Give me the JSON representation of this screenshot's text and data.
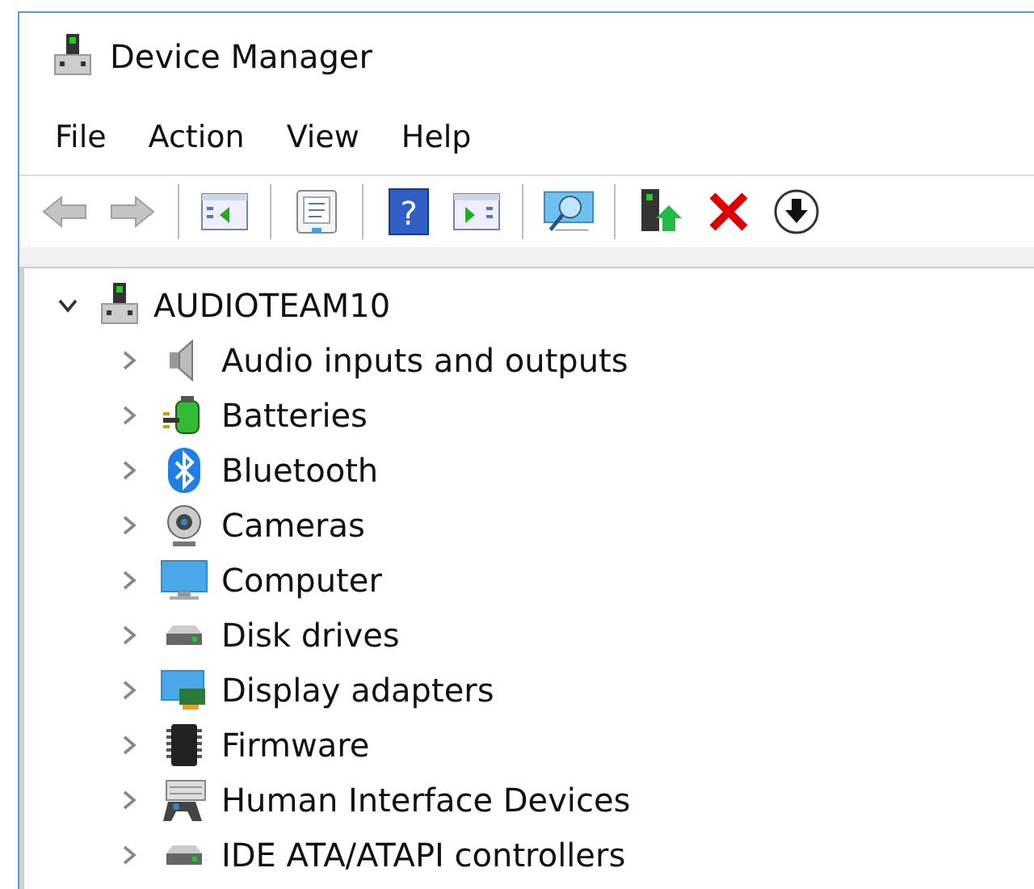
{
  "window": {
    "title": "Device Manager"
  },
  "menu": [
    {
      "label": "File"
    },
    {
      "label": "Action"
    },
    {
      "label": "View"
    },
    {
      "label": "Help"
    }
  ],
  "toolbar": [
    {
      "kind": "back"
    },
    {
      "kind": "forward"
    },
    {
      "kind": "separator"
    },
    {
      "kind": "pane-left"
    },
    {
      "kind": "separator"
    },
    {
      "kind": "document"
    },
    {
      "kind": "separator"
    },
    {
      "kind": "help",
      "glyph": "?"
    },
    {
      "kind": "pane-right"
    },
    {
      "kind": "separator"
    },
    {
      "kind": "scan"
    },
    {
      "kind": "separator"
    },
    {
      "kind": "update"
    },
    {
      "kind": "remove"
    },
    {
      "kind": "download"
    }
  ],
  "tree": {
    "label": "AUDIOTEAM10",
    "expanded": true,
    "children": [
      {
        "label": "Audio inputs and outputs",
        "kind": "speaker",
        "expanded": false
      },
      {
        "label": "Batteries",
        "kind": "battery",
        "expanded": false
      },
      {
        "label": "Bluetooth",
        "kind": "bluetooth",
        "expanded": false
      },
      {
        "label": "Cameras",
        "kind": "camera",
        "expanded": false
      },
      {
        "label": "Computer",
        "kind": "monitor",
        "expanded": false
      },
      {
        "label": "Disk drives",
        "kind": "disk",
        "expanded": false
      },
      {
        "label": "Display adapters",
        "kind": "adapter",
        "expanded": false
      },
      {
        "label": "Firmware",
        "kind": "chip",
        "expanded": false
      },
      {
        "label": "Human Interface Devices",
        "kind": "hid",
        "expanded": false
      },
      {
        "label": "IDE ATA/ATAPI controllers",
        "kind": "disk",
        "expanded": false
      }
    ]
  }
}
